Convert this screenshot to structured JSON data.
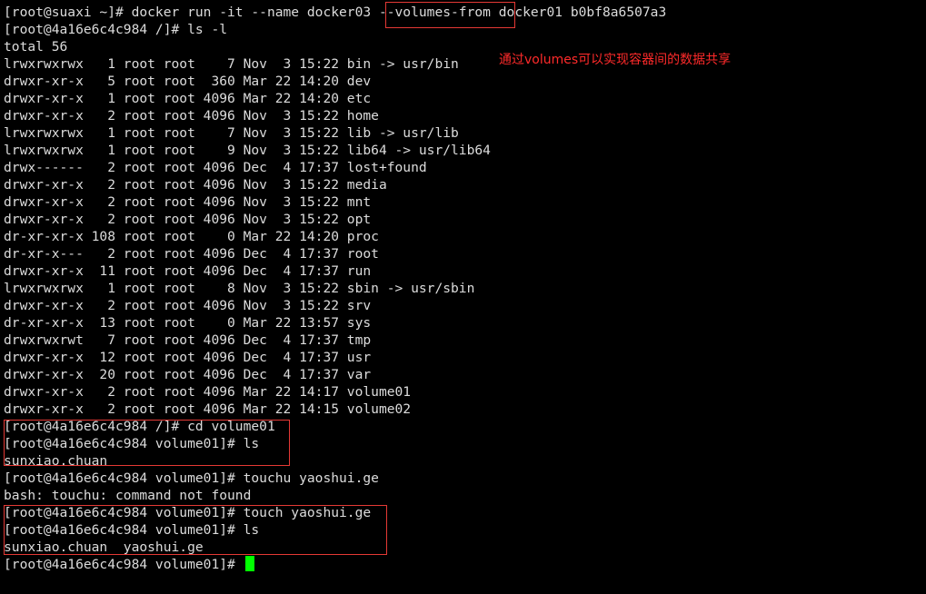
{
  "terminal": {
    "background": "#000000",
    "text_color": "#dcdcdc",
    "cursor_color": "#00ff00",
    "lines": [
      "[root@suaxi ~]# docker run -it --name docker03 --volumes-from docker01 b0bf8a6507a3",
      "[root@4a16e6c4c984 /]# ls -l",
      "total 56",
      "lrwxrwxrwx   1 root root    7 Nov  3 15:22 bin -> usr/bin",
      "drwxr-xr-x   5 root root  360 Mar 22 14:20 dev",
      "drwxr-xr-x   1 root root 4096 Mar 22 14:20 etc",
      "drwxr-xr-x   2 root root 4096 Nov  3 15:22 home",
      "lrwxrwxrwx   1 root root    7 Nov  3 15:22 lib -> usr/lib",
      "lrwxrwxrwx   1 root root    9 Nov  3 15:22 lib64 -> usr/lib64",
      "drwx------   2 root root 4096 Dec  4 17:37 lost+found",
      "drwxr-xr-x   2 root root 4096 Nov  3 15:22 media",
      "drwxr-xr-x   2 root root 4096 Nov  3 15:22 mnt",
      "drwxr-xr-x   2 root root 4096 Nov  3 15:22 opt",
      "dr-xr-xr-x 108 root root    0 Mar 22 14:20 proc",
      "dr-xr-x---   2 root root 4096 Dec  4 17:37 root",
      "drwxr-xr-x  11 root root 4096 Dec  4 17:37 run",
      "lrwxrwxrwx   1 root root    8 Nov  3 15:22 sbin -> usr/sbin",
      "drwxr-xr-x   2 root root 4096 Nov  3 15:22 srv",
      "dr-xr-xr-x  13 root root    0 Mar 22 13:57 sys",
      "drwxrwxrwt   7 root root 4096 Dec  4 17:37 tmp",
      "drwxr-xr-x  12 root root 4096 Dec  4 17:37 usr",
      "drwxr-xr-x  20 root root 4096 Dec  4 17:37 var",
      "drwxr-xr-x   2 root root 4096 Mar 22 14:17 volume01",
      "drwxr-xr-x   2 root root 4096 Mar 22 14:15 volume02",
      "[root@4a16e6c4c984 /]# cd volume01",
      "[root@4a16e6c4c984 volume01]# ls",
      "sunxiao.chuan",
      "[root@4a16e6c4c984 volume01]# touchu yaoshui.ge",
      "bash: touchu: command not found",
      "[root@4a16e6c4c984 volume01]# touch yaoshui.ge",
      "[root@4a16e6c4c984 volume01]# ls",
      "sunxiao.chuan  yaoshui.ge",
      "[root@4a16e6c4c984 volume01]# "
    ]
  },
  "annotation": {
    "note": "通过volumes可以实现容器间的数据共享",
    "color": "#e53935"
  }
}
